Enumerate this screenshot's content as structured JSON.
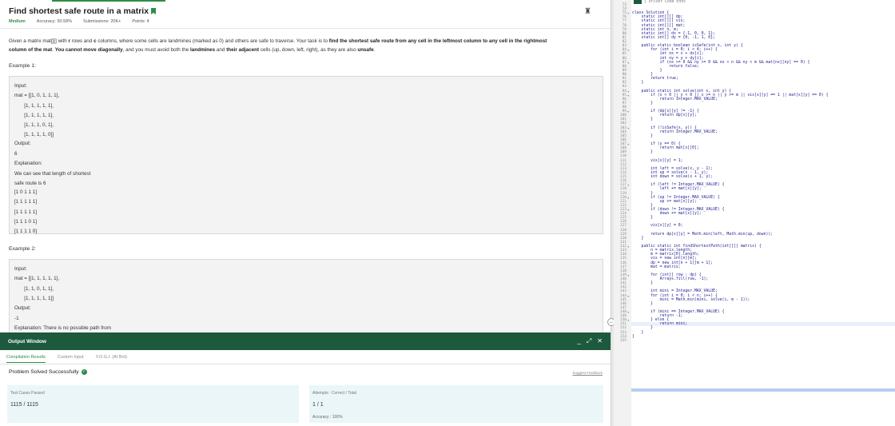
{
  "problem": {
    "title": "Find shortest safe route in a matrix",
    "difficulty": "Medium",
    "accuracy": "Accuracy: 50.58%",
    "submissions": "Submissions: 20K+",
    "points": "Points: 4",
    "statement_l1_a": "Given a matrix mat[][] with ",
    "statement_l1_b": "r",
    "statement_l1_c": " rows and ",
    "statement_l1_d": "c",
    "statement_l1_e": " columns, where some cells are landmines (marked as 0) and others are safe to traverse. Your task is to ",
    "statement_l1_f": "find the shortest safe route from any cell in the leftmost column to any cell in the rightmost",
    "statement_l2_a": "column of the mat",
    "statement_l2_b": ". ",
    "statement_l2_c": "You cannot move diagonally",
    "statement_l2_d": ", and you must avoid both the ",
    "statement_l2_e": "landmines",
    "statement_l2_f": " and ",
    "statement_l2_g": "their adjacent",
    "statement_l2_h": " cells (up, down, left, right), as they are also ",
    "statement_l2_i": "unsafe",
    "statement_l2_j": "."
  },
  "example1": {
    "title": "Example 1:",
    "lines": [
      "Input:",
      "mat = [[1, 0, 1, 1, 1],",
      "       [1, 1, 1, 1, 1],",
      "       [1, 1, 1, 1, 1],",
      "       [1, 1, 1, 0, 1],",
      "       [1, 1, 1, 1, 0]]",
      "Output:",
      "6",
      "Explanation:",
      "We can see that length of shortest",
      "safe route is 6",
      "[1 0 1 1 1]",
      "[1 1 1 1 1]",
      "[1 1 1 1 1]",
      "[1 1 1 0 1]",
      "[1 1 1 1 0]"
    ]
  },
  "example2": {
    "title": "Example 2:",
    "lines": [
      "Input:",
      "mat = [[1, 1, 1, 1, 1],",
      "       [1, 1, 0, 1, 1],",
      "       [1, 1, 1, 1, 1]]",
      "Output:",
      "-1",
      "Explanation: There is no possible path from"
    ]
  },
  "output_window": {
    "title": "Output Window",
    "tabs": [
      "Compilation Results",
      "Custom Input",
      "Y.O.G.I. (AI Bot)"
    ],
    "status": "Problem Solved Successfully",
    "suggest": "Suggest Feedback",
    "tests_label": "Test Cases Passed",
    "tests_value": "1115 / 1115",
    "attempts_label": "Attempts : Correct / Total",
    "attempts_value": "1 / 1",
    "accuracy": "Accuracy : 100%"
  },
  "editor": {
    "header_comment": "} Driver Code Ends",
    "line_numbers": [
      "73",
      "74",
      "75",
      "76",
      "77",
      "78",
      "79",
      "80",
      "81",
      "82",
      "83",
      "84",
      "85",
      "86",
      "87",
      "88",
      "89",
      "90",
      "91",
      "92",
      "93",
      "94",
      "95",
      "96",
      "97",
      "98",
      "99",
      "100",
      "101",
      "102",
      "103",
      "104",
      "105",
      "106",
      "107",
      "108",
      "109",
      "110",
      "111",
      "112",
      "113",
      "114",
      "115",
      "116",
      "117",
      "118",
      "119",
      "120",
      "121",
      "122",
      "123",
      "124",
      "125",
      "126",
      "127",
      "128",
      "129",
      "130",
      "131",
      "132",
      "133",
      "134",
      "135",
      "136",
      "137",
      "138",
      "139",
      "140",
      "141",
      "142",
      "143",
      "144",
      "145",
      "146",
      "147",
      "148",
      "149",
      "150",
      "151",
      "152",
      "153",
      "154",
      "155"
    ],
    "fold_markers": {
      "75": "▾",
      "84": "▾",
      "87": "▾",
      "94": "▾",
      "95": "▾",
      "99": "▾",
      "103": "▾",
      "107": "▾",
      "117": "▾",
      "120": "▾",
      "123": "▾",
      "132": "▾",
      "139": "▾",
      "144": "▾",
      "148": "▾",
      "150": "▾"
    },
    "code": [
      "",
      "",
      "class Solution {",
      "    static int[][] dp;",
      "    static int[][] vis;",
      "    static int[][] mat;",
      "    static int n, m;",
      "    static int[] dx = {-1, 0, 0, 1};",
      "    static int[] dy = {0, -1, 1, 0};",
      "",
      "    public static boolean isSafe(int x, int y) {",
      "        for (int i = 0; i < 4; i++) {",
      "            int nx = x + dx[i];",
      "            int ny = y + dy[i];",
      "            if (nx >= 0 && ny >= 0 && nx < n && ny < m && mat[nx][ny] == 0) {",
      "                return false;",
      "            }",
      "        }",
      "        return true;",
      "    }",
      "",
      "    public static int solve(int x, int y) {",
      "        if (x < 0 || y < 0 || x >= n || y >= m || vis[x][y] == 1 || mat[x][y] == 0) {",
      "            return Integer.MAX_VALUE;",
      "        }",
      "",
      "        if (dp[x][y] != -1) {",
      "            return dp[x][y];",
      "        }",
      "",
      "        if (!isSafe(x, y)) {",
      "            return Integer.MAX_VALUE;",
      "        }",
      "",
      "        if (y == 0) {",
      "            return mat[x][0];",
      "        }",
      "",
      "        vis[x][y] = 1;",
      "",
      "        int left = solve(x, y - 1);",
      "        int up = solve(x - 1, y);",
      "        int down = solve(x + 1, y);",
      "",
      "        if (left != Integer.MAX_VALUE) {",
      "            left += mat[x][y];",
      "        }",
      "        if (up != Integer.MAX_VALUE) {",
      "            up += mat[x][y];",
      "        }",
      "        if (down != Integer.MAX_VALUE) {",
      "            down += mat[x][y];",
      "        }",
      "",
      "        vis[x][y] = 0;",
      "",
      "        return dp[x][y] = Math.min(left, Math.min(up, down));",
      "    }",
      "",
      "    public static int findShortestPath(int[][] matrix) {",
      "        n = matrix.length;",
      "        m = matrix[0].length;",
      "        vis = new int[n][m];",
      "        dp = new int[n + 1][m + 1];",
      "        mat = matrix;",
      "",
      "        for (int[] row : dp) {",
      "            Arrays.fill(row, -1);",
      "        }",
      "",
      "        int mini = Integer.MAX_VALUE;",
      "        for (int i = 0; i < n; i++) {",
      "            mini = Math.min(mini, solve(i, m - 1));",
      "        }",
      "",
      "        if (mini == Integer.MAX_VALUE) {",
      "            return -1;",
      "        } else {",
      "            return mini;",
      "        }",
      "    }",
      "}",
      ""
    ]
  }
}
